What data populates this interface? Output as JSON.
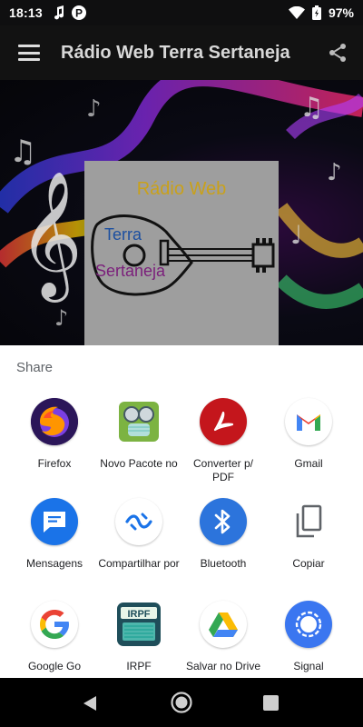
{
  "status_bar": {
    "time": "18:13",
    "battery": "97%",
    "icons": [
      "music-note-icon",
      "p-app-icon",
      "wifi-icon",
      "battery-icon"
    ]
  },
  "app_bar": {
    "title": "Rádio Web Terra Sertaneja",
    "menu_icon": "hamburger-menu-icon",
    "share_icon": "share-icon"
  },
  "logo": {
    "line1": "Rádio Web",
    "line2": "Terra",
    "line3": "Sertaneja"
  },
  "share_sheet": {
    "title": "Share",
    "apps": [
      {
        "label": "Firefox",
        "icon": "firefox-icon",
        "color": "#3b1d6b"
      },
      {
        "label": "Novo Pacote no",
        "icon": "novo-pacote-icon",
        "color": "#cfe3b0"
      },
      {
        "label": "Converter p/ PDF",
        "icon": "acrobat-icon",
        "color": "#c4161c"
      },
      {
        "label": "Gmail",
        "icon": "gmail-icon",
        "color": "#ffffff"
      },
      {
        "label": "Mensagens",
        "icon": "messages-icon",
        "color": "#1a73e8"
      },
      {
        "label": "Compartilhar por",
        "icon": "nearby-share-icon",
        "color": "#ffffff"
      },
      {
        "label": "Bluetooth",
        "icon": "bluetooth-icon",
        "color": "#2c74dc"
      },
      {
        "label": "Copiar",
        "icon": "copy-icon",
        "color": "#ffffff"
      },
      {
        "label": "Google Go",
        "icon": "google-go-icon",
        "color": "#ffffff"
      },
      {
        "label": "IRPF",
        "icon": "irpf-icon",
        "color": "#2b6e7a"
      },
      {
        "label": "Salvar no Drive",
        "icon": "google-drive-icon",
        "color": "#ffffff"
      },
      {
        "label": "Signal",
        "icon": "signal-icon",
        "color": "#3a76f0"
      }
    ]
  },
  "nav_bar": {
    "back": "back-icon",
    "home": "home-icon",
    "recents": "recents-icon"
  }
}
